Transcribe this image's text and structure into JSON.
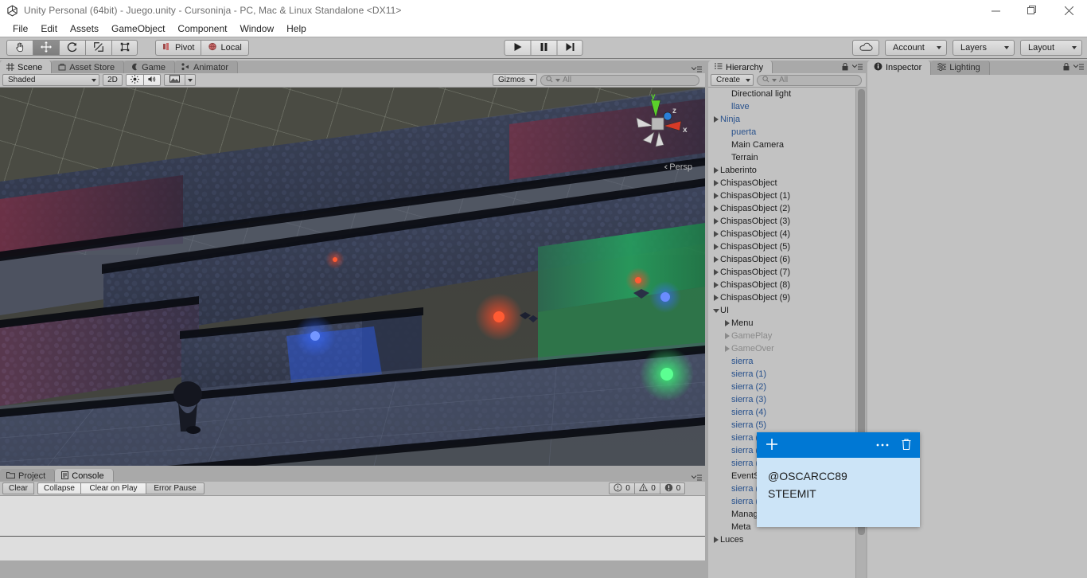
{
  "window": {
    "title": "Unity Personal (64bit) - Juego.unity - Cursoninja - PC, Mac & Linux Standalone <DX11>",
    "logo_icon": "unity-logo-icon",
    "minimize_icon": "minimize-icon",
    "restore_icon": "restore-icon",
    "close_icon": "close-icon"
  },
  "menubar": {
    "items": [
      {
        "label": "File"
      },
      {
        "label": "Edit"
      },
      {
        "label": "Assets"
      },
      {
        "label": "GameObject"
      },
      {
        "label": "Component"
      },
      {
        "label": "Window"
      },
      {
        "label": "Help"
      }
    ]
  },
  "toolbar": {
    "tools": [
      {
        "name": "hand-tool",
        "icon": "hand-icon",
        "active": false
      },
      {
        "name": "move-tool",
        "icon": "move-icon",
        "active": true
      },
      {
        "name": "rotate-tool",
        "icon": "rotate-icon",
        "active": false
      },
      {
        "name": "scale-tool",
        "icon": "scale-icon",
        "active": false
      },
      {
        "name": "rect-tool",
        "icon": "rect-transform-icon",
        "active": false
      }
    ],
    "pivot_label": "Pivot",
    "local_label": "Local",
    "play_icon": "play-icon",
    "pause_icon": "pause-icon",
    "step_icon": "step-icon",
    "cloud_icon": "cloud-icon",
    "account_label": "Account",
    "layers_label": "Layers",
    "layout_label": "Layout"
  },
  "scene_panel": {
    "tabs": [
      {
        "label": "Scene",
        "icon": "scene-icon",
        "active": true
      },
      {
        "label": "Asset Store",
        "icon": "asset-store-icon",
        "active": false
      },
      {
        "label": "Game",
        "icon": "game-icon",
        "active": false
      },
      {
        "label": "Animator",
        "icon": "animator-icon",
        "active": false
      }
    ],
    "draw_mode": "Shaded",
    "mode_2d": "2D",
    "lighting_icon": "sun-icon",
    "audio_icon": "speaker-icon",
    "effects_icon": "image-icon",
    "gizmos_label": "Gizmos",
    "search_placeholder": "All",
    "search_value": "",
    "persp_label": "Persp",
    "gizmo_axes": {
      "x": "x",
      "y": "y",
      "z": "z"
    },
    "axis_colors": {
      "x": "#d73a27",
      "y": "#5bd02a",
      "z": "#2a7fd7"
    }
  },
  "hierarchy": {
    "tab_label": "Hierarchy",
    "tab_icon": "hierarchy-icon",
    "lock_icon": "lock-icon",
    "menu_icon": "panel-menu-icon",
    "create_label": "Create",
    "search_placeholder": "All",
    "search_value": "",
    "items": [
      {
        "label": "Directional light",
        "indent": 1,
        "arrow": false,
        "style": "normal"
      },
      {
        "label": "llave",
        "indent": 1,
        "arrow": false,
        "style": "prefab"
      },
      {
        "label": "Ninja",
        "indent": 0,
        "arrow": true,
        "style": "prefab"
      },
      {
        "label": "puerta",
        "indent": 1,
        "arrow": false,
        "style": "prefab"
      },
      {
        "label": "Main Camera",
        "indent": 1,
        "arrow": false,
        "style": "normal"
      },
      {
        "label": "Terrain",
        "indent": 1,
        "arrow": false,
        "style": "normal"
      },
      {
        "label": "Laberinto",
        "indent": 0,
        "arrow": true,
        "style": "normal"
      },
      {
        "label": "ChispasObject",
        "indent": 0,
        "arrow": true,
        "style": "normal"
      },
      {
        "label": "ChispasObject (1)",
        "indent": 0,
        "arrow": true,
        "style": "normal"
      },
      {
        "label": "ChispasObject (2)",
        "indent": 0,
        "arrow": true,
        "style": "normal"
      },
      {
        "label": "ChispasObject (3)",
        "indent": 0,
        "arrow": true,
        "style": "normal"
      },
      {
        "label": "ChispasObject (4)",
        "indent": 0,
        "arrow": true,
        "style": "normal"
      },
      {
        "label": "ChispasObject (5)",
        "indent": 0,
        "arrow": true,
        "style": "normal"
      },
      {
        "label": "ChispasObject (6)",
        "indent": 0,
        "arrow": true,
        "style": "normal"
      },
      {
        "label": "ChispasObject (7)",
        "indent": 0,
        "arrow": true,
        "style": "normal"
      },
      {
        "label": "ChispasObject (8)",
        "indent": 0,
        "arrow": true,
        "style": "normal"
      },
      {
        "label": "ChispasObject (9)",
        "indent": 0,
        "arrow": true,
        "style": "normal"
      },
      {
        "label": "UI",
        "indent": 0,
        "arrow": true,
        "expanded": true,
        "style": "normal"
      },
      {
        "label": "Menu",
        "indent": 1,
        "arrow": true,
        "style": "normal"
      },
      {
        "label": "GamePlay",
        "indent": 1,
        "arrow": true,
        "style": "inactive"
      },
      {
        "label": "GameOver",
        "indent": 1,
        "arrow": true,
        "style": "inactive"
      },
      {
        "label": "sierra",
        "indent": 1,
        "arrow": false,
        "style": "prefab"
      },
      {
        "label": "sierra (1)",
        "indent": 1,
        "arrow": false,
        "style": "prefab"
      },
      {
        "label": "sierra (2)",
        "indent": 1,
        "arrow": false,
        "style": "prefab"
      },
      {
        "label": "sierra (3)",
        "indent": 1,
        "arrow": false,
        "style": "prefab"
      },
      {
        "label": "sierra (4)",
        "indent": 1,
        "arrow": false,
        "style": "prefab"
      },
      {
        "label": "sierra (5)",
        "indent": 1,
        "arrow": false,
        "style": "prefab"
      },
      {
        "label": "sierra (6)",
        "indent": 1,
        "arrow": false,
        "style": "prefab"
      },
      {
        "label": "sierra (7)",
        "indent": 1,
        "arrow": false,
        "style": "prefab"
      },
      {
        "label": "sierra (8)",
        "indent": 1,
        "arrow": false,
        "style": "prefab"
      },
      {
        "label": "EventSystem",
        "indent": 1,
        "arrow": false,
        "style": "normal"
      },
      {
        "label": "sierra (9)",
        "indent": 1,
        "arrow": false,
        "style": "prefab"
      },
      {
        "label": "sierra (10)",
        "indent": 1,
        "arrow": false,
        "style": "prefab"
      },
      {
        "label": "Manager",
        "indent": 1,
        "arrow": false,
        "style": "normal"
      },
      {
        "label": "Meta",
        "indent": 1,
        "arrow": false,
        "style": "normal"
      },
      {
        "label": "Luces",
        "indent": 0,
        "arrow": true,
        "style": "normal"
      }
    ]
  },
  "inspector": {
    "tabs": [
      {
        "label": "Inspector",
        "icon": "inspector-icon",
        "active": true
      },
      {
        "label": "Lighting",
        "icon": "lighting-icon",
        "active": false
      }
    ],
    "lock_icon": "lock-icon",
    "menu_icon": "panel-menu-icon"
  },
  "console": {
    "tabs": [
      {
        "label": "Project",
        "icon": "project-icon",
        "active": false
      },
      {
        "label": "Console",
        "icon": "console-icon",
        "active": true
      }
    ],
    "buttons": [
      {
        "label": "Clear"
      },
      {
        "label": "Collapse"
      },
      {
        "label": "Clear on Play"
      },
      {
        "label": "Error Pause"
      }
    ],
    "counters": [
      {
        "icon": "info-icon",
        "count": "0"
      },
      {
        "icon": "warning-icon",
        "count": "0"
      },
      {
        "icon": "error-icon",
        "count": "0"
      }
    ],
    "menu_icon": "panel-menu-icon"
  },
  "sticky_note": {
    "add_icon": "plus-icon",
    "more_icon": "more-options-icon",
    "delete_icon": "trash-icon",
    "lines": [
      "@OSCARCC89",
      "STEEMIT"
    ],
    "header_color": "#0078d4",
    "body_color": "#cce4f7"
  }
}
